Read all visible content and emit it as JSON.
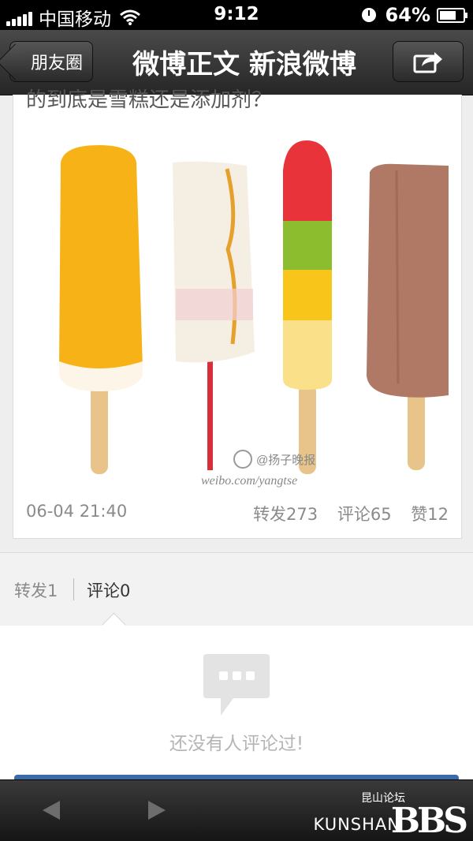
{
  "status_bar": {
    "carrier": "中国移动",
    "time": "9:12",
    "battery": "64%",
    "battery_level": 0.64
  },
  "nav": {
    "back_label": "朋友圈",
    "title": "微博正文 新浪微博"
  },
  "post": {
    "text_partial": "的到底是雪糕还是添加剂？",
    "image_watermark": "@扬子晚报",
    "image_watermark_url": "weibo.com/yangtse",
    "timestamp": "06-04 21:40",
    "reposts": "转发273",
    "comments": "评论65",
    "likes": "赞12"
  },
  "tabs": {
    "forward": "转发1",
    "comment": "评论0"
  },
  "empty_state": {
    "text": "还没有人评论过!"
  },
  "watermark": {
    "small": "昆山论坛",
    "big": "KUNSHAN",
    "bbs": "BBS"
  },
  "colors": {
    "accent_blue": "#3b6aa6",
    "toolbar": "#1f1f1f"
  }
}
